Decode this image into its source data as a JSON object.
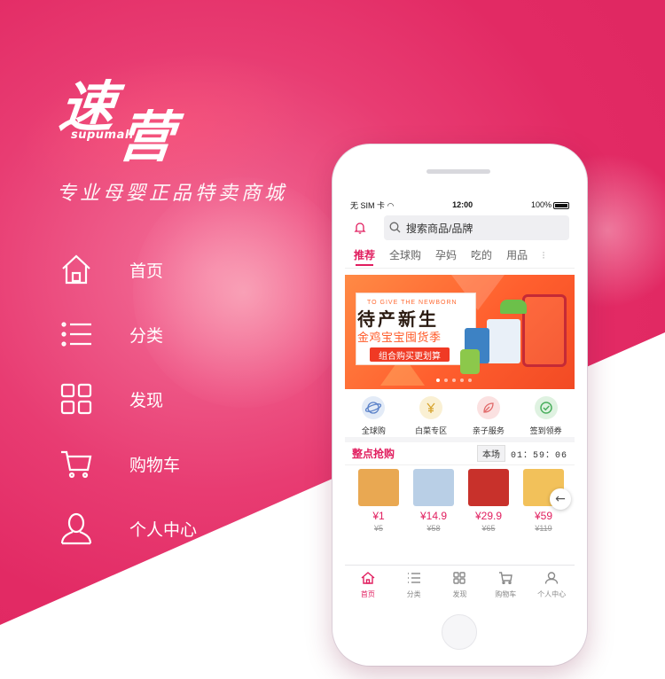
{
  "brand": {
    "logo_text": "速营",
    "logo_latin": "supumall",
    "slogan": "专业母婴正品特卖商城"
  },
  "side_menu": [
    {
      "label": "首页",
      "icon": "home-icon"
    },
    {
      "label": "分类",
      "icon": "list-icon"
    },
    {
      "label": "发现",
      "icon": "grid-icon"
    },
    {
      "label": "购物车",
      "icon": "cart-icon"
    },
    {
      "label": "个人中心",
      "icon": "user-icon"
    }
  ],
  "phone": {
    "status": {
      "carrier": "无 SIM 卡",
      "time": "12:00",
      "battery": "100%"
    },
    "search_placeholder": "搜索商品/品牌",
    "tabs": [
      {
        "label": "推荐",
        "active": true
      },
      {
        "label": "全球购"
      },
      {
        "label": "孕妈"
      },
      {
        "label": "吃的"
      },
      {
        "label": "用品"
      }
    ],
    "banner": {
      "tagline": "TO GIVE THE NEWBORN",
      "title": "待产新生",
      "subtitle": "金鸡宝宝囤货季",
      "button": "组合购买更划算"
    },
    "quick_links": [
      {
        "label": "全球购",
        "icon": "globe-icon",
        "color": "#5b82c9"
      },
      {
        "label": "白菜专区",
        "icon": "yen-icon",
        "color": "#e8b63a"
      },
      {
        "label": "亲子服务",
        "icon": "leaf-icon",
        "color": "#e16a6a"
      },
      {
        "label": "签到领券",
        "icon": "check-icon",
        "color": "#5bb86a"
      }
    ],
    "flash_sale": {
      "title": "整点抢购",
      "session_label": "本场",
      "countdown": "01：59：06"
    },
    "products": [
      {
        "price": "¥1",
        "orig": "¥5",
        "color": "#e9a852"
      },
      {
        "price": "¥14.9",
        "orig": "¥58",
        "color": "#b9cfe6"
      },
      {
        "price": "¥29.9",
        "orig": "¥65",
        "color": "#c8312b"
      },
      {
        "price": "¥59",
        "orig": "¥119",
        "color": "#f2c15a"
      }
    ],
    "bottom_nav": [
      {
        "label": "首页",
        "active": true
      },
      {
        "label": "分类"
      },
      {
        "label": "发现"
      },
      {
        "label": "购物车"
      },
      {
        "label": "个人中心"
      }
    ]
  }
}
